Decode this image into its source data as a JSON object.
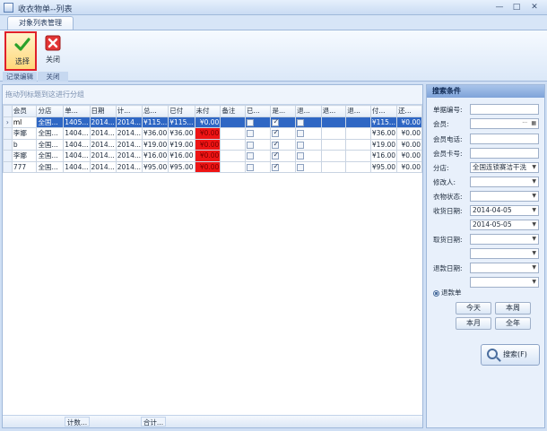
{
  "window": {
    "title": "收衣物单--列表",
    "min": "—",
    "max": "□",
    "close": "✕"
  },
  "ribbon": {
    "tab": "对象列表管理",
    "select_label": "选择",
    "close_label": "关闭",
    "group_edit": "记录编辑",
    "group_close": "关闭",
    "colors": {
      "select_highlight": "#e0202a"
    }
  },
  "grid": {
    "group_hint": "拖动列标题到这进行分组",
    "columns": [
      "会员",
      "分店",
      "单...",
      "日期",
      "计...",
      "总...",
      "已付",
      "未付",
      "备注",
      "已...",
      "是...",
      "退...",
      "退...",
      "退...",
      "付...",
      "还..."
    ],
    "rows": [
      {
        "member": "ml",
        "branch": "全国...",
        "no": "1405...",
        "date": "2014...",
        "calc": "2014...",
        "total": "¥115...",
        "paid": "¥115...",
        "unpaid": "¥0.00",
        "note": "",
        "c1": false,
        "c2": true,
        "c3": false,
        "r1": "",
        "r2": "",
        "pay": "¥115...",
        "back": "¥0.00",
        "unpaid_red": false
      },
      {
        "member": "李娜",
        "branch": "全国...",
        "no": "1404...",
        "date": "2014...",
        "calc": "2014...",
        "total": "¥36.00",
        "paid": "¥36.00",
        "unpaid": "¥0.00",
        "note": "",
        "c1": false,
        "c2": true,
        "c3": false,
        "r1": "",
        "r2": "",
        "pay": "¥36.00",
        "back": "¥0.00",
        "unpaid_red": true
      },
      {
        "member": "b",
        "branch": "全国...",
        "no": "1404...",
        "date": "2014...",
        "calc": "2014...",
        "total": "¥19.00",
        "paid": "¥19.00",
        "unpaid": "¥0.00",
        "note": "",
        "c1": false,
        "c2": true,
        "c3": false,
        "r1": "",
        "r2": "",
        "pay": "¥19.00",
        "back": "¥0.00",
        "unpaid_red": true
      },
      {
        "member": "李娜",
        "branch": "全国...",
        "no": "1404...",
        "date": "2014...",
        "calc": "2014...",
        "total": "¥16.00",
        "paid": "¥16.00",
        "unpaid": "¥0.00",
        "note": "",
        "c1": false,
        "c2": true,
        "c3": false,
        "r1": "",
        "r2": "",
        "pay": "¥16.00",
        "back": "¥0.00",
        "unpaid_red": true
      },
      {
        "member": "777",
        "branch": "全国...",
        "no": "1404...",
        "date": "2014...",
        "calc": "2014...",
        "total": "¥95.00",
        "paid": "¥95.00",
        "unpaid": "¥0.00",
        "note": "",
        "c1": false,
        "c2": true,
        "c3": false,
        "r1": "",
        "r2": "",
        "pay": "¥95.00",
        "back": "¥0.00",
        "unpaid_red": true
      }
    ],
    "footer_count": "计数...",
    "footer_sum": "合计...",
    "colors": {
      "selected_row": "#2f67c4",
      "unpaid_red": "#ee1414"
    }
  },
  "search": {
    "title": "搜索条件",
    "order_no_label": "单据编号:",
    "member_label": "会员:",
    "member_phone_label": "会员电话:",
    "member_card_label": "会员卡号:",
    "branch_label": "分店:",
    "branch_value": "全国连锁赛洁干洗",
    "modifier_label": "修改人:",
    "clothes_status_label": "衣物状态:",
    "receive_date_label": "收货日期:",
    "receive_from": "2014-04-05",
    "receive_to": "2014-05-05",
    "pickup_date_label": "取货日期:",
    "refund_date_label": "退款日期:",
    "refund_toggle": "退款单",
    "today": "今天",
    "this_week": "本周",
    "this_month": "本月",
    "whole_year": "全年",
    "search_button": "搜索(F)",
    "member_ellipsis": "···"
  }
}
